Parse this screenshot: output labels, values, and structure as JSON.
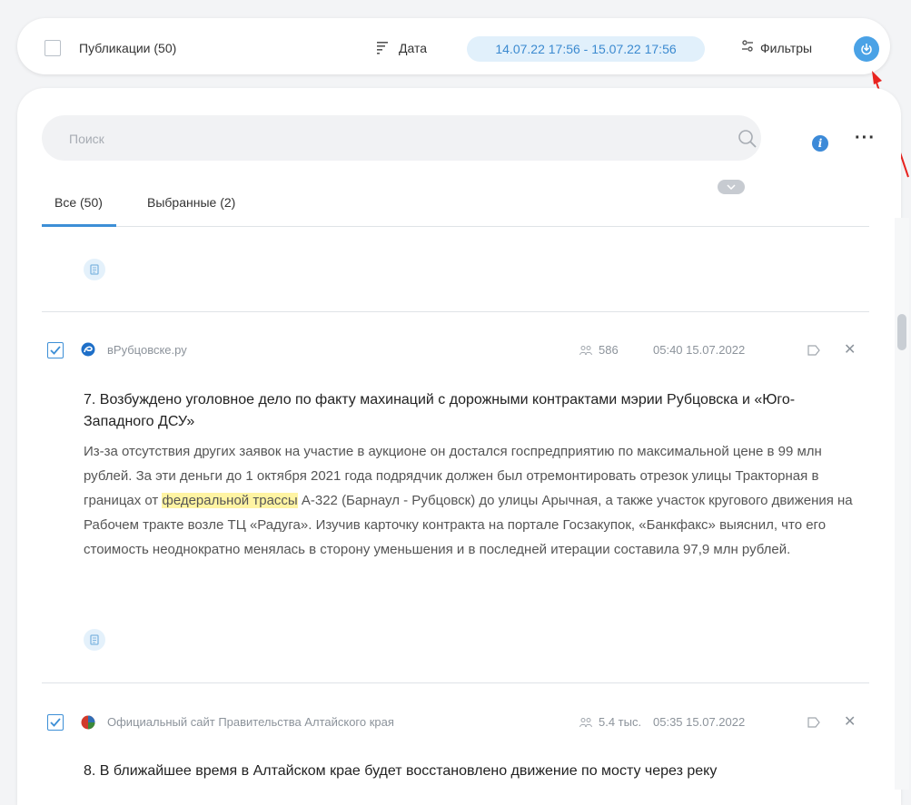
{
  "toolbar": {
    "publications_label": "Публикации (50)",
    "sort_label": "Дата",
    "date_range": "14.07.22 17:56 - 15.07.22 17:56",
    "filters_label": "Фильтры"
  },
  "search": {
    "placeholder": "Поиск"
  },
  "tabs": [
    {
      "label": "Все (50)",
      "active": true
    },
    {
      "label": "Выбранные (2)",
      "active": false
    }
  ],
  "items": [
    {
      "checked": true,
      "source": "вРубцовске.ру",
      "reach": "586",
      "time": "05:40 15.07.2022",
      "title": "7. Возбуждено уголовное дело по факту махинаций с дорожными контрактами мэрии Рубцовска и «Юго-Западного ДСУ»",
      "text_before": "Из-за отсутствия других заявок на участие в аукционе он достался госпредприятию по максимальной цене в 99 млн рублей. За эти деньги до 1 октября 2021 года подрядчик должен был отремонтировать отрезок улицы Тракторная в границах от ",
      "highlight": "федеральной трассы",
      "text_after": " А-322 (Барнаул - Рубцовск) до улицы Арычная, а также участок кругового движения на Рабочем тракте возле ТЦ «Радуга». Изучив карточку контракта на портале Госзакупок, «Банкфакс» выяснил, что его стоимость неоднократно менялась в сторону уменьшения и в последней итерации составила 97,9 млн рублей."
    },
    {
      "checked": true,
      "source": "Официальный сайт Правительства Алтайского края",
      "reach": "5.4 тыс.",
      "time": "05:35 15.07.2022",
      "title": "8. В ближайшее время в Алтайском крае будет восстановлено движение по мосту через реку"
    }
  ],
  "colors": {
    "accent": "#3d8fd6",
    "highlight": "#fff4a3",
    "date_chip_bg": "#e1f0fb"
  }
}
